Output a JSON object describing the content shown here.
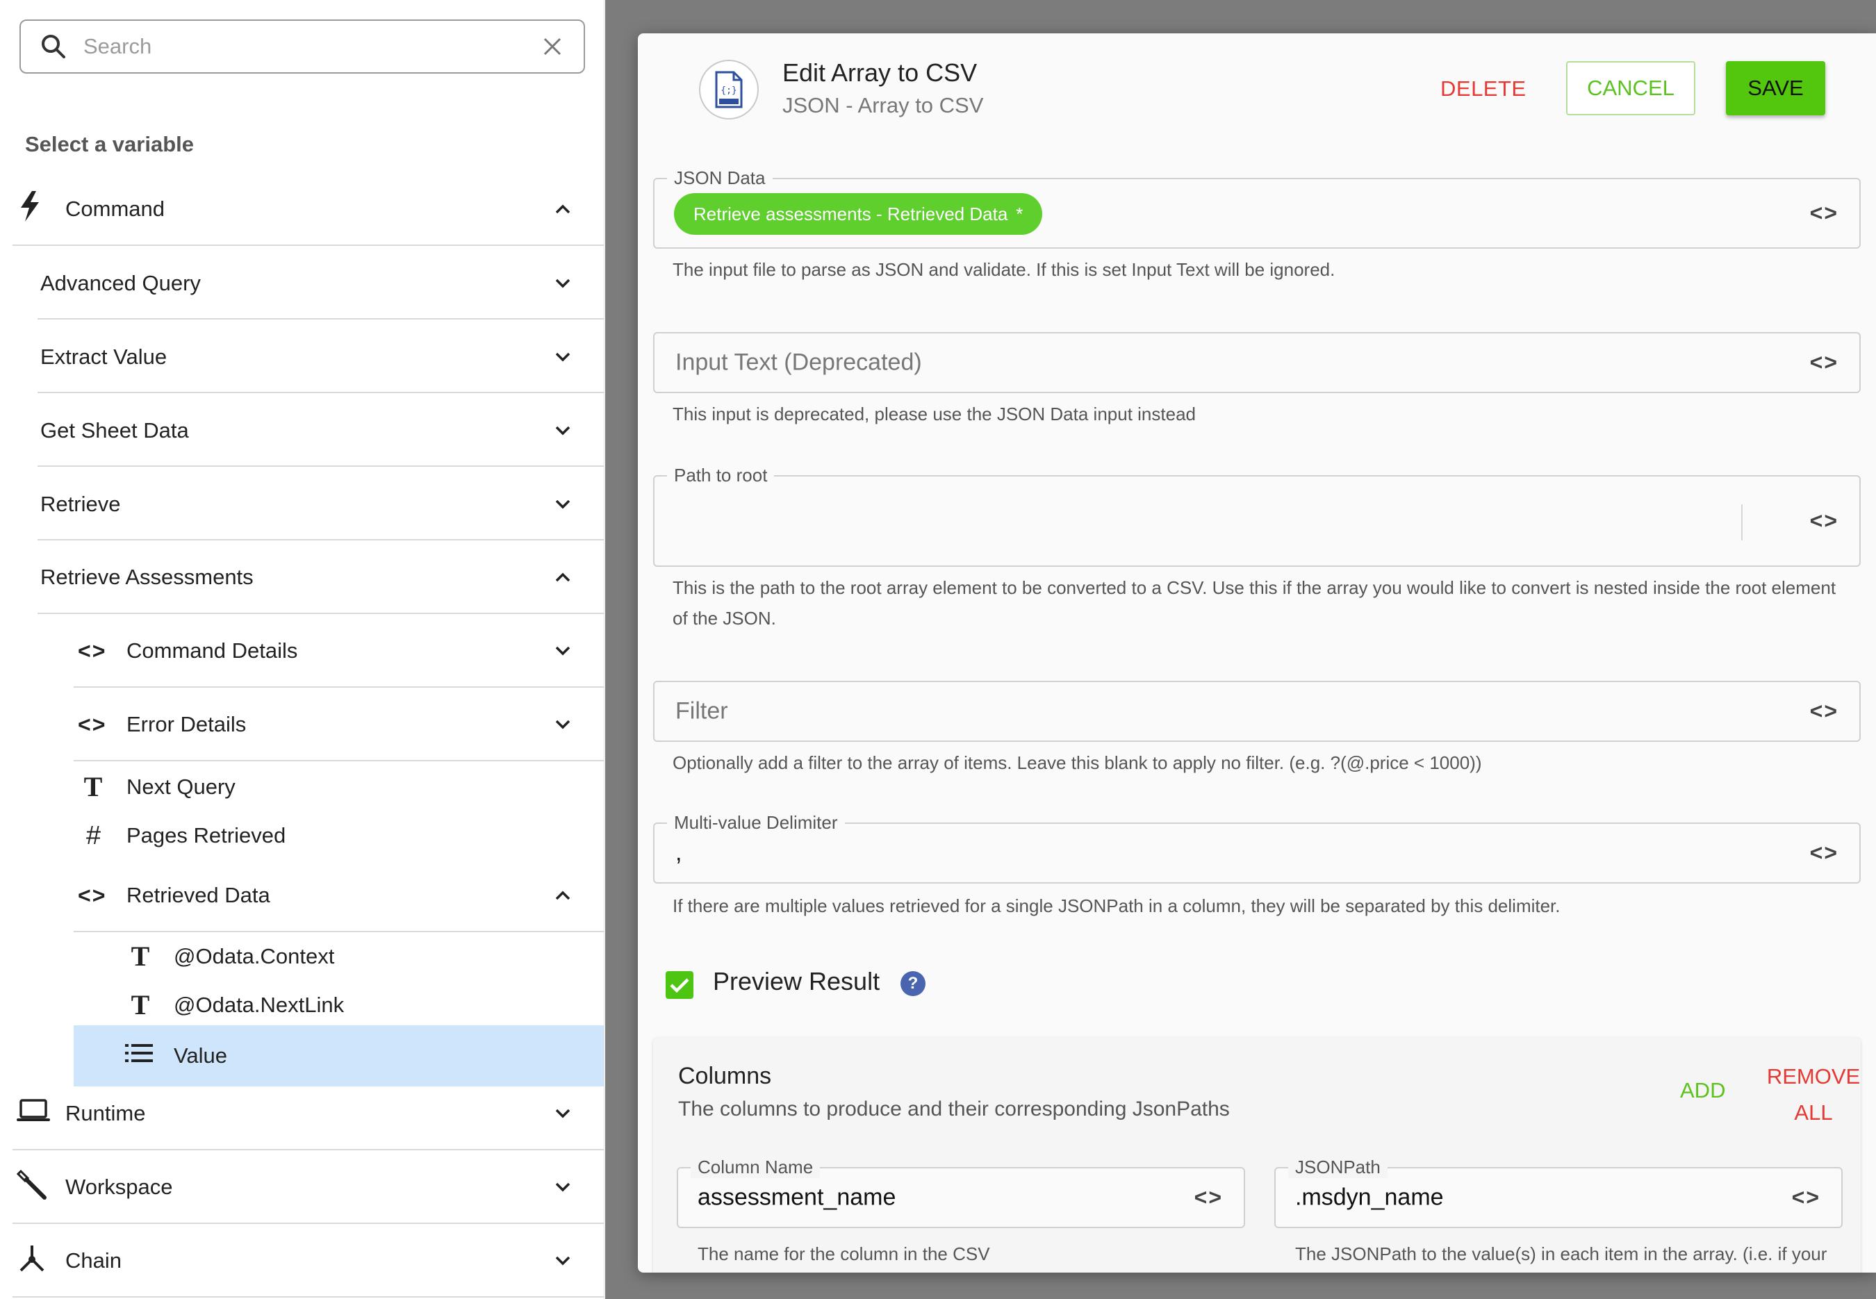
{
  "search": {
    "placeholder": "Search"
  },
  "sidebar": {
    "heading": "Select a variable",
    "groups": {
      "command": {
        "label": "Command"
      },
      "runtime": {
        "label": "Runtime"
      },
      "workspace": {
        "label": "Workspace"
      },
      "chain": {
        "label": "Chain"
      }
    },
    "commands": {
      "advanced_query": "Advanced Query",
      "extract_value": "Extract Value",
      "get_sheet_data": "Get Sheet Data",
      "retrieve": "Retrieve",
      "retrieve_assessments": "Retrieve Assessments"
    },
    "retrieve_assessments_children": {
      "command_details": "Command Details",
      "error_details": "Error Details",
      "next_query": "Next Query",
      "pages_retrieved": "Pages Retrieved",
      "retrieved_data": "Retrieved Data"
    },
    "retrieved_data_children": {
      "odata_context": "@Odata.Context",
      "odata_nextlink": "@Odata.NextLink",
      "value": "Value"
    }
  },
  "modal": {
    "title": "Edit Array to CSV",
    "subtitle": "JSON - Array to CSV",
    "icon": "json-file-icon",
    "delete_label": "DELETE",
    "cancel_label": "CANCEL",
    "save_label": "SAVE",
    "fields": {
      "json_data": {
        "label": "JSON Data",
        "chip": "Retrieve assessments - Retrieved Data",
        "chip_mark": "*",
        "helper": "The input file to parse as JSON and validate. If this is set Input Text will be ignored."
      },
      "input_text": {
        "placeholder": "Input Text (Deprecated)",
        "helper": "This input is deprecated, please use the JSON Data input instead"
      },
      "path_to_root": {
        "label": "Path to root",
        "value": "",
        "helper": "This is the path to the root array element to be converted to a CSV. Use this if the array you would like to convert is nested inside the root element of the JSON."
      },
      "filter": {
        "placeholder": "Filter",
        "helper": "Optionally add a filter to the array of items. Leave this blank to apply no filter. (e.g. ?(@.price < 1000))"
      },
      "multi_value_delimiter": {
        "label": "Multi-value Delimiter",
        "value": ",",
        "helper": "If there are multiple values retrieved for a single JSONPath in a column, they will be separated by this delimiter."
      }
    },
    "preview": {
      "label": "Preview Result",
      "checked": true,
      "help": "?"
    },
    "columns": {
      "title": "Columns",
      "subtitle": "The columns to produce and their corresponding JsonPaths",
      "add_label": "ADD",
      "remove_line1": "REMOVE",
      "remove_line2": "ALL",
      "column_name": {
        "label": "Column Name",
        "value": "assessment_name",
        "helper": "The name for the column in the CSV"
      },
      "jsonpath": {
        "label": "JSONPath",
        "value": ".msdyn_name",
        "helper": "The JSONPath to the value(s) in each item in the array. (i.e. if your"
      }
    },
    "code_toggle": "<>"
  },
  "colors": {
    "accent_green": "#52c70d",
    "danger_red": "#e53935",
    "chip_green": "#5fcf2e",
    "selected_row": "#cfe5fb",
    "help_blue": "#4a65b0"
  }
}
